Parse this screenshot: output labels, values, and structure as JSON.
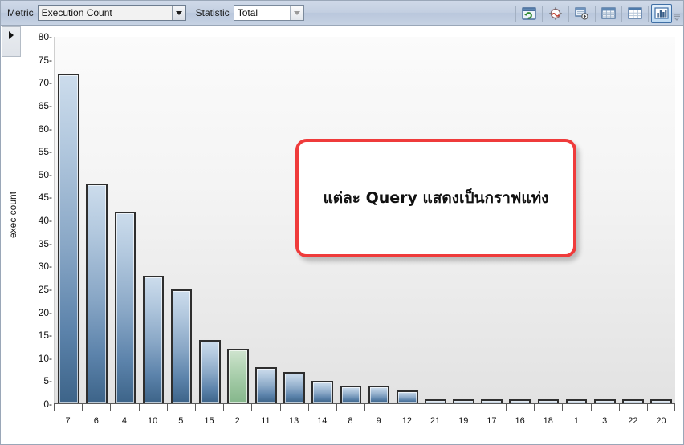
{
  "toolbar": {
    "metric_label": "Metric",
    "metric_value": "Execution Count",
    "statistic_label": "Statistic",
    "statistic_value": "Total",
    "buttons": [
      {
        "name": "refresh-window-icon",
        "title": "Refresh"
      },
      {
        "name": "target-compass-icon",
        "title": "Locate"
      },
      {
        "name": "export-grid-icon",
        "title": "Export"
      },
      {
        "name": "grid-view-icon",
        "title": "Grid View"
      },
      {
        "name": "table-view-icon",
        "title": "Table View"
      },
      {
        "name": "bar-chart-view-icon",
        "title": "Chart View"
      }
    ],
    "overflow_label": "More"
  },
  "chart_data": {
    "type": "bar",
    "title": "",
    "xlabel": "",
    "ylabel": "exec count",
    "ylim": [
      0,
      80
    ],
    "yticks": [
      80,
      75,
      70,
      65,
      60,
      55,
      50,
      45,
      40,
      35,
      30,
      25,
      20,
      15,
      10,
      5,
      0
    ],
    "grid": false,
    "categories": [
      "7",
      "6",
      "4",
      "10",
      "5",
      "15",
      "2",
      "11",
      "13",
      "14",
      "8",
      "9",
      "12",
      "21",
      "19",
      "17",
      "16",
      "18",
      "1",
      "3",
      "22",
      "20"
    ],
    "values": [
      72,
      48,
      42,
      28,
      25,
      14,
      12,
      8,
      7,
      5,
      4,
      4,
      3,
      1,
      1,
      1,
      1,
      1,
      1,
      1,
      1,
      1
    ],
    "highlight_index": 6,
    "bar_color": "#5c83ab",
    "highlight_color": "#9cc6a0",
    "bar_border_color": "#2e2e2e"
  },
  "callout": {
    "text": "แต่ละ Query แสดงเป็นกราฟแท่ง",
    "border_color": "#ef3b3b"
  },
  "expander": {
    "label": "Expand panel"
  }
}
